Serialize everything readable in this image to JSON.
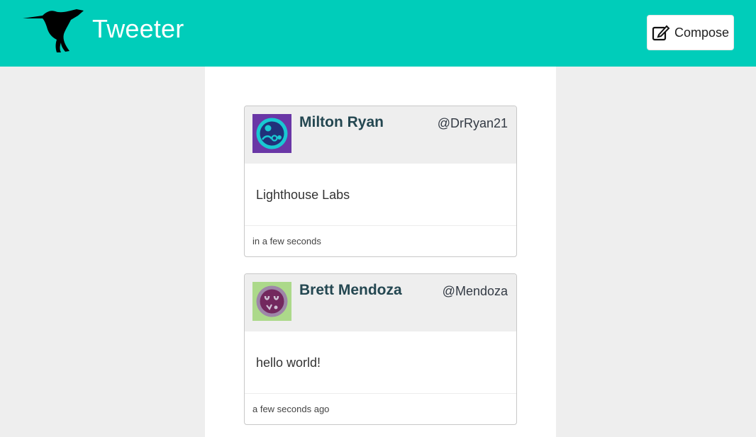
{
  "header": {
    "brand": "Tweeter",
    "compose_label": "Compose",
    "logo_icon": "hummingbird-logo",
    "compose_icon": "edit-icon",
    "background_color": "#00cdba"
  },
  "tweets": [
    {
      "name": "Milton Ryan",
      "handle": "@DrRyan21",
      "text": "Lighthouse Labs",
      "time": "in a few seconds",
      "avatar_icon": "robot-avatar-icon"
    },
    {
      "name": "Brett Mendoza",
      "handle": "@Mendoza",
      "text": "hello world!",
      "time": "a few seconds ago",
      "avatar_icon": "face-avatar-icon"
    }
  ]
}
